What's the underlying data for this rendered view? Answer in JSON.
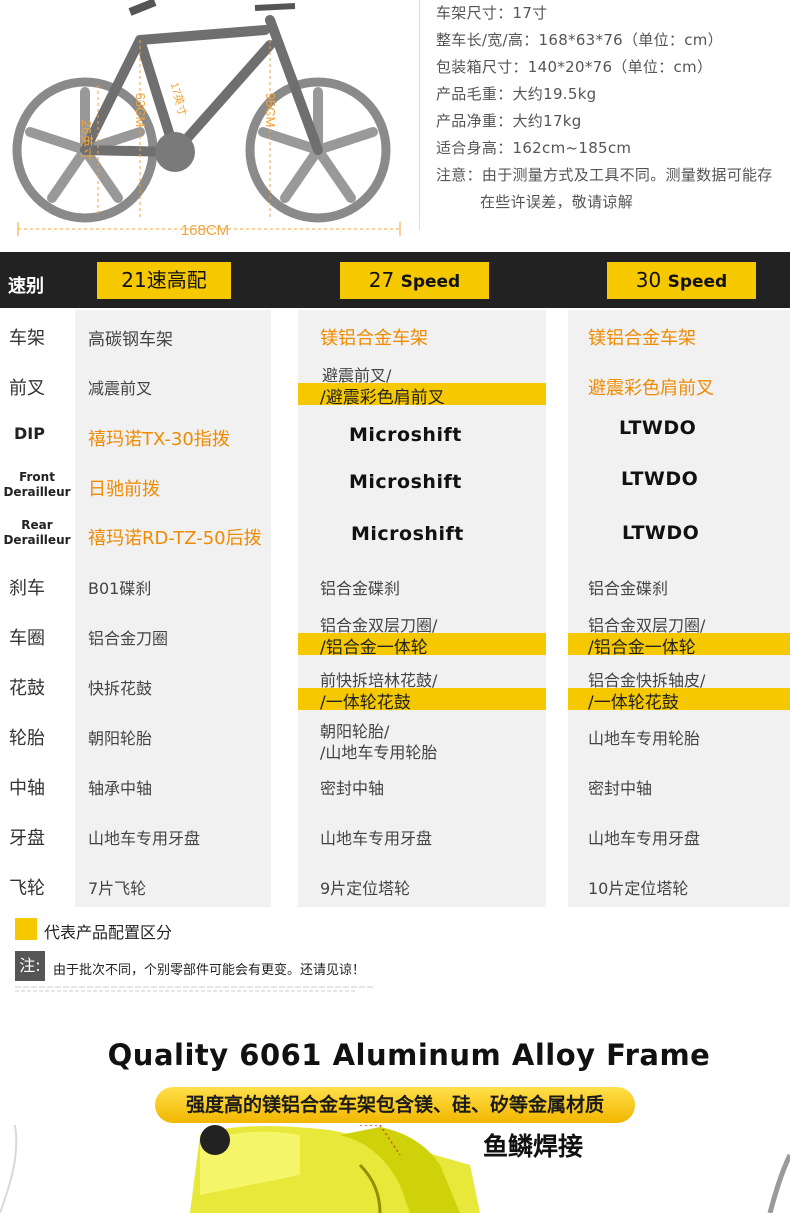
{
  "bike_diagram": {
    "dim_wheel": "26英寸",
    "dim_seat": "63CM",
    "dim_frame": "17英寸",
    "dim_height": "95CM",
    "dim_length": "168CM"
  },
  "specs": [
    "车架尺寸：17寸",
    "整车长/宽/高：168*63*76（单位：cm）",
    "包装箱尺寸：140*20*76（单位：cm）",
    "产品毛重：大约19.5kg",
    "产品净重：大约17kg",
    "适合身高：162cm~185cm",
    "注意：由于测量方式及工具不同。测量数据可能存",
    "在些许误差，敬请谅解"
  ],
  "header": {
    "label": "速别",
    "col1": "21速高配",
    "col2_num": "27",
    "col2_word": "Speed",
    "col3_num": "30",
    "col3_word": "Speed"
  },
  "rows": {
    "labels": [
      "车架",
      "前叉",
      "DIP",
      "Front Derailleur",
      "Rear Derailleur",
      "刹车",
      "车圈",
      "花鼓",
      "轮胎",
      "中轴",
      "牙盘",
      "飞轮"
    ],
    "col1": [
      "高碳钢车架",
      "减震前叉",
      "禧玛诺TX-30指拨",
      "日驰前拨",
      "禧玛诺RD-TZ-50后拨",
      "B01碟刹",
      "铝合金刀圈",
      "快拆花鼓",
      "朝阳轮胎",
      "轴承中轴",
      "山地车专用牙盘",
      "7片飞轮"
    ],
    "col2": {
      "frame": "镁铝合金车架",
      "fork_a": "避震前叉/",
      "fork_b": "/避震彩色肩前叉",
      "dip": "Microshift",
      "front": "Microshift",
      "rear": "Microshift",
      "brake": "铝合金碟刹",
      "rim_a": "铝合金双层刀圈/",
      "rim_b": "/铝合金一体轮",
      "hub_a": "前快拆培林花鼓/",
      "hub_b": "/一体轮花鼓",
      "tire_a": "朝阳轮胎/",
      "tire_b": "/山地车专用轮胎",
      "bb": "密封中轴",
      "crank": "山地车专用牙盘",
      "fw": "9片定位塔轮"
    },
    "col3": {
      "frame": "镁铝合金车架",
      "fork": "避震彩色肩前叉",
      "dip": "LTWDO",
      "front": "LTWDO",
      "rear": "LTWDO",
      "brake": "铝合金碟刹",
      "rim_a": "铝合金双层刀圈/",
      "rim_b": "/铝合金一体轮",
      "hub_a": "铝合金快拆轴皮/",
      "hub_b": "/一体轮花鼓",
      "tire": "山地车专用轮胎",
      "bb": "密封中轴",
      "crank": "山地车专用牙盘",
      "fw": "10片定位塔轮"
    }
  },
  "legend": "代表产品配置区分",
  "note_tag": "注:",
  "note": "由于批次不同，个别零部件可能会有更变。还请见谅！",
  "quality_title": "Quality 6061 Aluminum Alloy Frame",
  "pill_text": "强度高的镁铝合金车架包含镁、硅、矽等金属材质",
  "weld_text": "鱼鳞焊接",
  "colors": {
    "accent": "#f6c800",
    "orange": "#f08a00",
    "header_bg": "#222222"
  }
}
